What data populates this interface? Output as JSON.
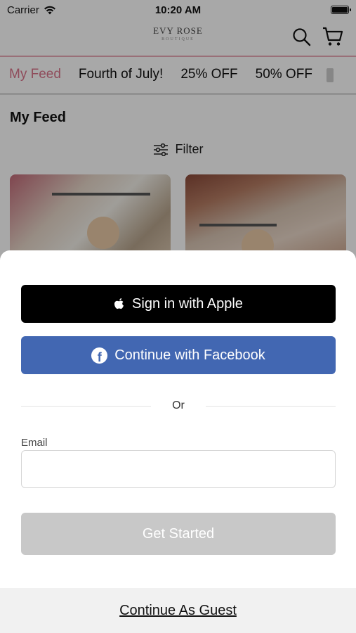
{
  "status_bar": {
    "carrier": "Carrier",
    "time": "10:20 AM"
  },
  "header": {
    "logo_text": "EVY ROSE",
    "logo_sub": "BOUTIQUE"
  },
  "tabs": [
    "My Feed",
    "Fourth of July!",
    "25% OFF",
    "50% OFF"
  ],
  "feed": {
    "title": "My Feed",
    "filter_label": "Filter"
  },
  "sheet": {
    "apple_label": "Sign in with Apple",
    "facebook_label": "Continue with Facebook",
    "or_label": "Or",
    "email_label": "Email",
    "email_value": "",
    "get_started_label": "Get Started",
    "guest_label": "Continue As Guest"
  },
  "colors": {
    "accent": "#d9748a",
    "facebook": "#4267b2",
    "disabled": "#c8c8c8"
  }
}
